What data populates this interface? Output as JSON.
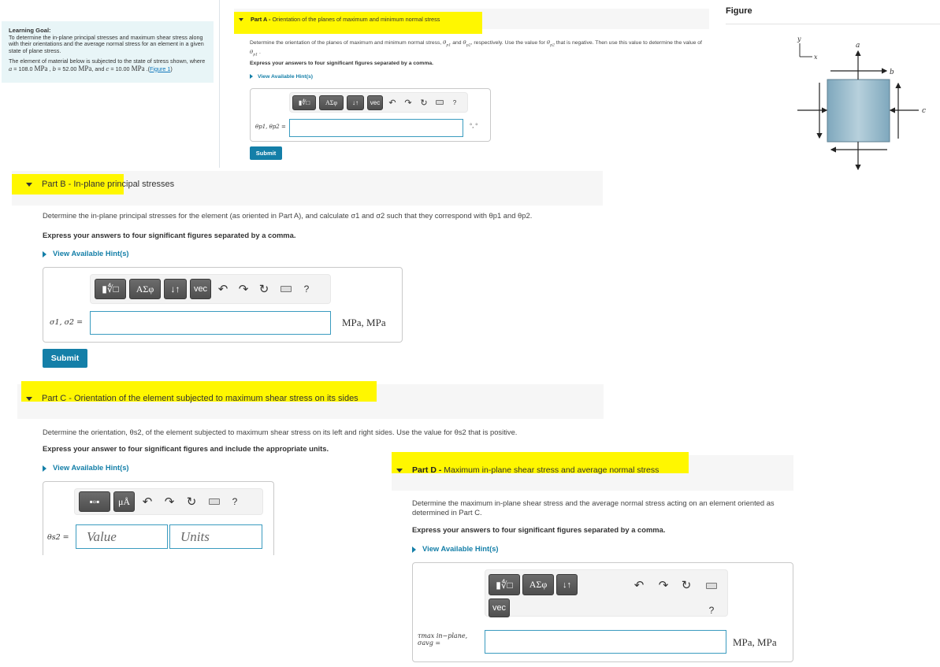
{
  "learning_goal": {
    "title": "Learning Goal:",
    "text": "To determine the in-plane principal stresses and maximum shear stress along with their orientations and the average normal stress for an element in a given state of plane stress.",
    "given_intro": "The element of material below is subjected to the state of stress shown, where ",
    "a_label": "a",
    "a_value": "108.0",
    "b_label": "b",
    "b_value": "52.00",
    "c_label": "c",
    "c_value": "10.00",
    "unit": "MPa",
    "and_text": ", and ",
    "figure_link": "Figure 1"
  },
  "figure": {
    "title": "Figure",
    "labels": {
      "y": "y",
      "x": "x",
      "a": "a",
      "b": "b",
      "c": "c"
    },
    "fill_color": "#8fb4c6"
  },
  "common": {
    "hint_link": "View Available Hint(s)",
    "submit": "Submit",
    "undo": "↶",
    "redo": "↷",
    "reset": "↻",
    "help": "?",
    "tb_templates": "▮∜□",
    "tb_greek": "ΑΣφ",
    "tb_arrows": "↓↑",
    "tb_vec": "vec",
    "tb_units_templates": "▪▫▪",
    "tb_units": "μÅ"
  },
  "partA": {
    "label": "Part A -",
    "title": "Orientation of the planes of maximum and minimum normal stress",
    "text1": "Determine the orientation of the planes of maximum and minimum normal stress, ",
    "text2": " and ",
    "text3": ", respectively.  Use the value for ",
    "text4": " that is negative. Then use this value to determine the value of ",
    "instruction": "Express your answers to four significant figures separated by a comma.",
    "answer_label": "θp1, θp2 =",
    "units": "°, °",
    "value": ""
  },
  "partB": {
    "label": "Part B",
    "title": " - In-plane principal stresses",
    "text": "Determine the in-plane principal stresses for the element (as oriented in Part A), and calculate σ1 and σ2 such that they correspond with θp1 and θp2.",
    "instruction": "Express your answers to four significant figures separated by a comma.",
    "answer_label": "σ1, σ2 =",
    "units": "MPa, MPa",
    "value": ""
  },
  "partC": {
    "label": "Part C",
    "title": " - Orientation of the element subjected to maximum shear stress on its sides",
    "text": "Determine the orientation, θs2, of the element subjected to maximum shear stress on its left and right sides. Use the value for θs2 that is positive.",
    "instruction": "Express your answer to four significant figures and include the appropriate units.",
    "answer_label": "θs2 =",
    "value_placeholder": "Value",
    "units_placeholder": "Units"
  },
  "partD": {
    "label": "Part D -",
    "title": " Maximum in-plane shear stress and average normal stress",
    "text": "Determine the maximum in-plane shear stress and the average normal stress acting on an element oriented as determined in Part C.",
    "instruction": "Express your answers to four significant figures separated by a comma.",
    "answer_label": "τmax in−plane, σavg =",
    "units": "MPa, MPa",
    "value": ""
  }
}
